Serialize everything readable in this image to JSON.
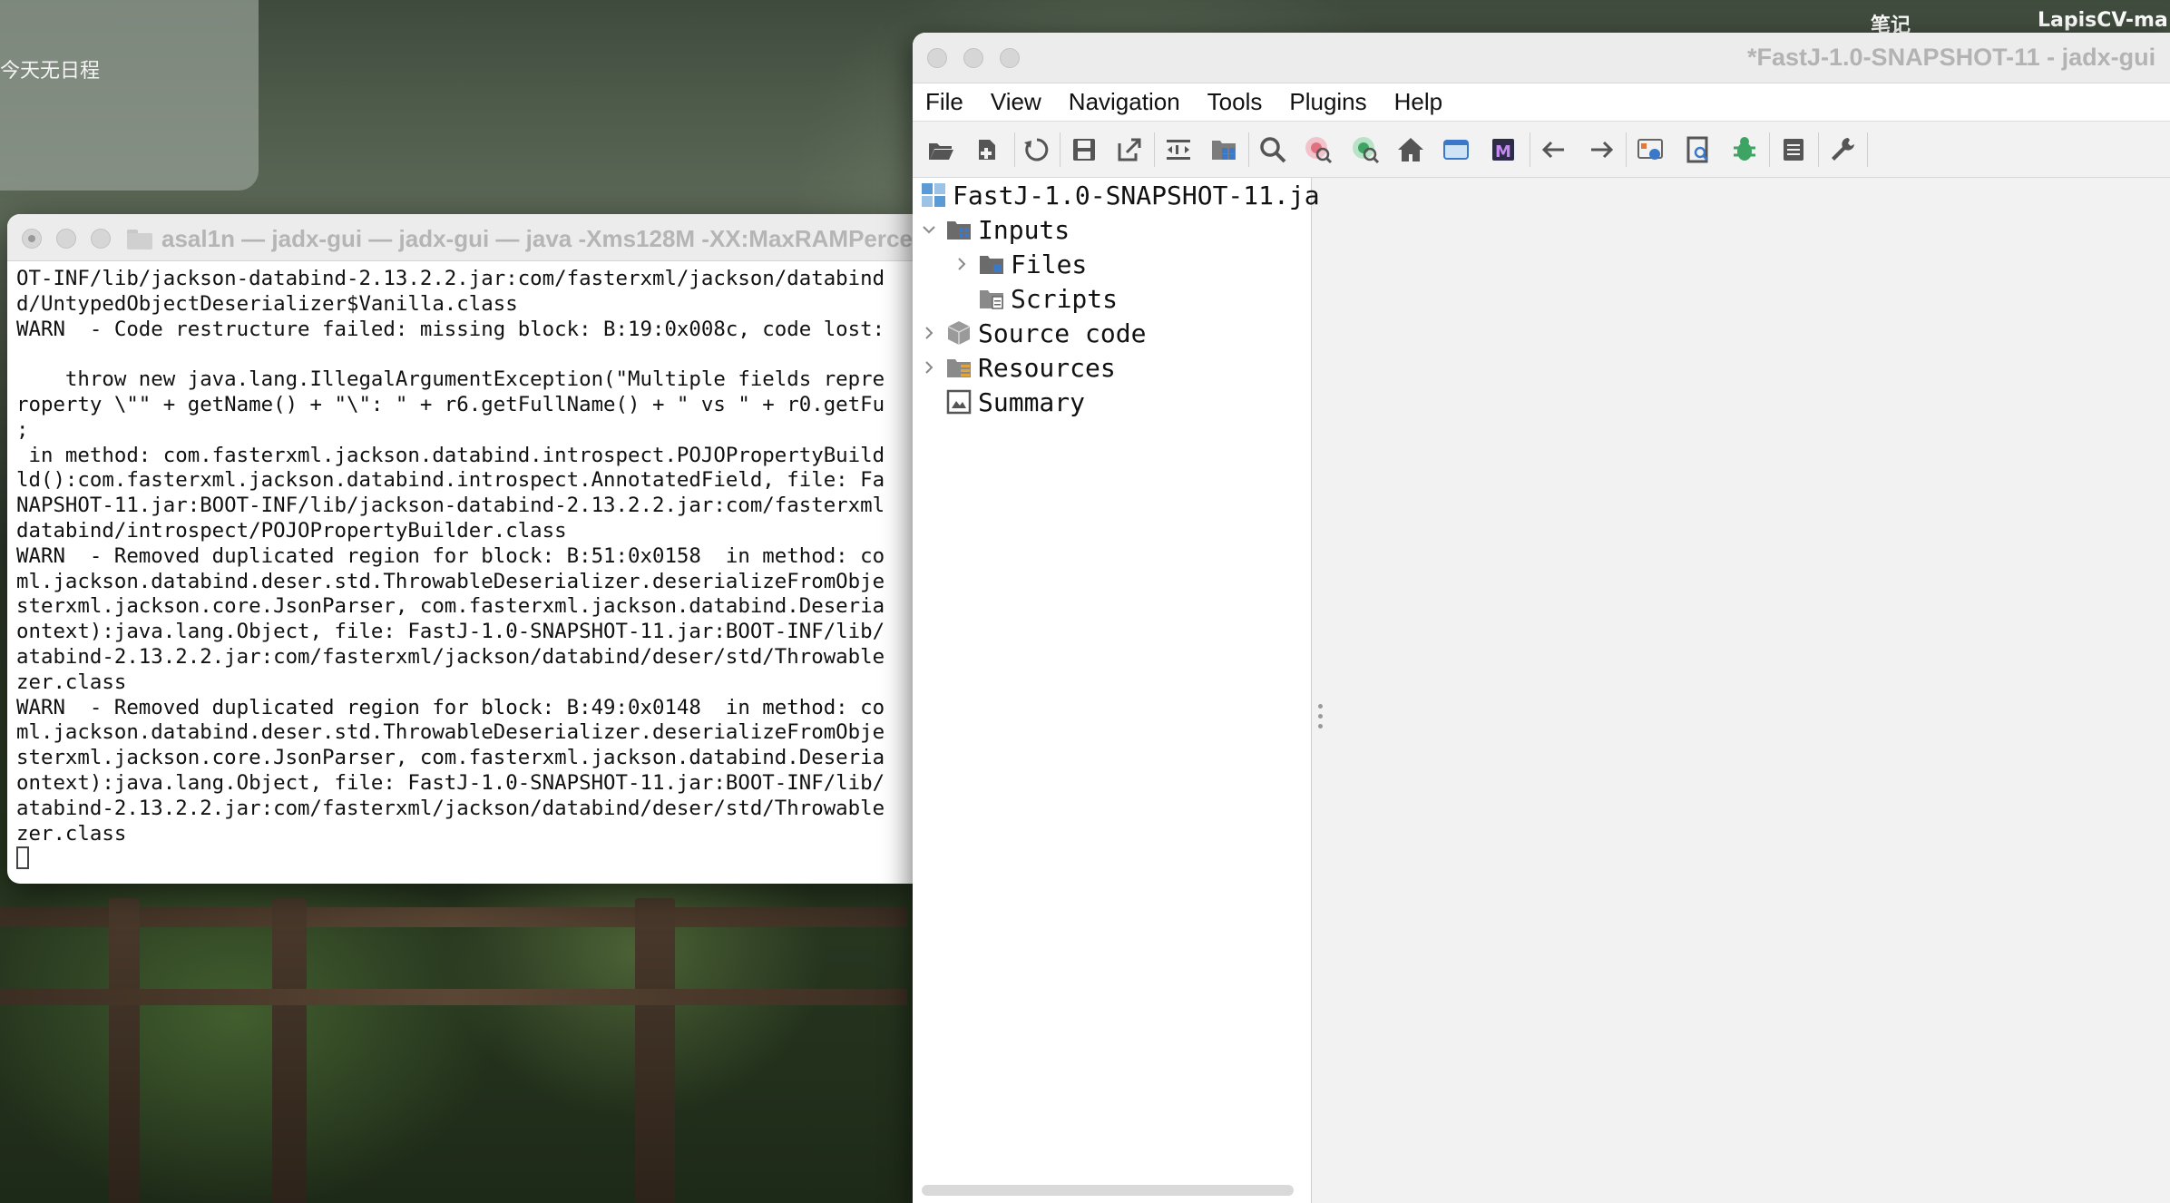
{
  "desktop": {
    "menubar_items": [
      "笔记",
      "LapisCV-ma"
    ],
    "calendar_widget_text": "今天无日程"
  },
  "terminal": {
    "title": "asal1n — jadx-gui — jadx-gui — java -Xms128M -XX:MaxRAMPerce",
    "lines": [
      "OT-INF/lib/jackson-databind-2.13.2.2.jar:com/fasterxml/jackson/databind",
      "d/UntypedObjectDeserializer$Vanilla.class",
      "WARN  - Code restructure failed: missing block: B:19:0x008c, code lost:",
      "",
      "    throw new java.lang.IllegalArgumentException(\"Multiple fields repre",
      "roperty \\\"\" + getName() + \"\\\": \" + r6.getFullName() + \" vs \" + r0.getFu",
      ";",
      " in method: com.fasterxml.jackson.databind.introspect.POJOPropertyBuild",
      "ld():com.fasterxml.jackson.databind.introspect.AnnotatedField, file: Fa",
      "NAPSHOT-11.jar:BOOT-INF/lib/jackson-databind-2.13.2.2.jar:com/fasterxml",
      "databind/introspect/POJOPropertyBuilder.class",
      "WARN  - Removed duplicated region for block: B:51:0x0158  in method: co",
      "ml.jackson.databind.deser.std.ThrowableDeserializer.deserializeFromObje",
      "sterxml.jackson.core.JsonParser, com.fasterxml.jackson.databind.Deseria",
      "ontext):java.lang.Object, file: FastJ-1.0-SNAPSHOT-11.jar:BOOT-INF/lib/",
      "atabind-2.13.2.2.jar:com/fasterxml/jackson/databind/deser/std/Throwable",
      "zer.class",
      "WARN  - Removed duplicated region for block: B:49:0x0148  in method: co",
      "ml.jackson.databind.deser.std.ThrowableDeserializer.deserializeFromObje",
      "sterxml.jackson.core.JsonParser, com.fasterxml.jackson.databind.Deseria",
      "ontext):java.lang.Object, file: FastJ-1.0-SNAPSHOT-11.jar:BOOT-INF/lib/",
      "atabind-2.13.2.2.jar:com/fasterxml/jackson/databind/deser/std/Throwable",
      "zer.class"
    ]
  },
  "jadx": {
    "title": "*FastJ-1.0-SNAPSHOT-11 - jadx-gui",
    "menu": [
      "File",
      "View",
      "Navigation",
      "Tools",
      "Plugins",
      "Help"
    ],
    "toolbar_icons": [
      "open-file-icon",
      "add-files-icon",
      "reload-icon",
      "save-all-icon",
      "export-icon",
      "sync-tree-icon",
      "flatten-packages-icon",
      "search-text-icon",
      "search-class-icon",
      "find-usage-icon",
      "home-icon",
      "deobfuscation-icon",
      "smali-icon",
      "back-icon",
      "forward-icon",
      "quark-icon",
      "bookmark-icon",
      "debug-icon",
      "log-viewer-icon",
      "preferences-icon"
    ],
    "tree": {
      "root": "FastJ-1.0-SNAPSHOT-11.jar",
      "inputs": "Inputs",
      "files": "Files",
      "scripts": "Scripts",
      "source_code": "Source code",
      "resources": "Resources",
      "summary": "Summary"
    }
  }
}
